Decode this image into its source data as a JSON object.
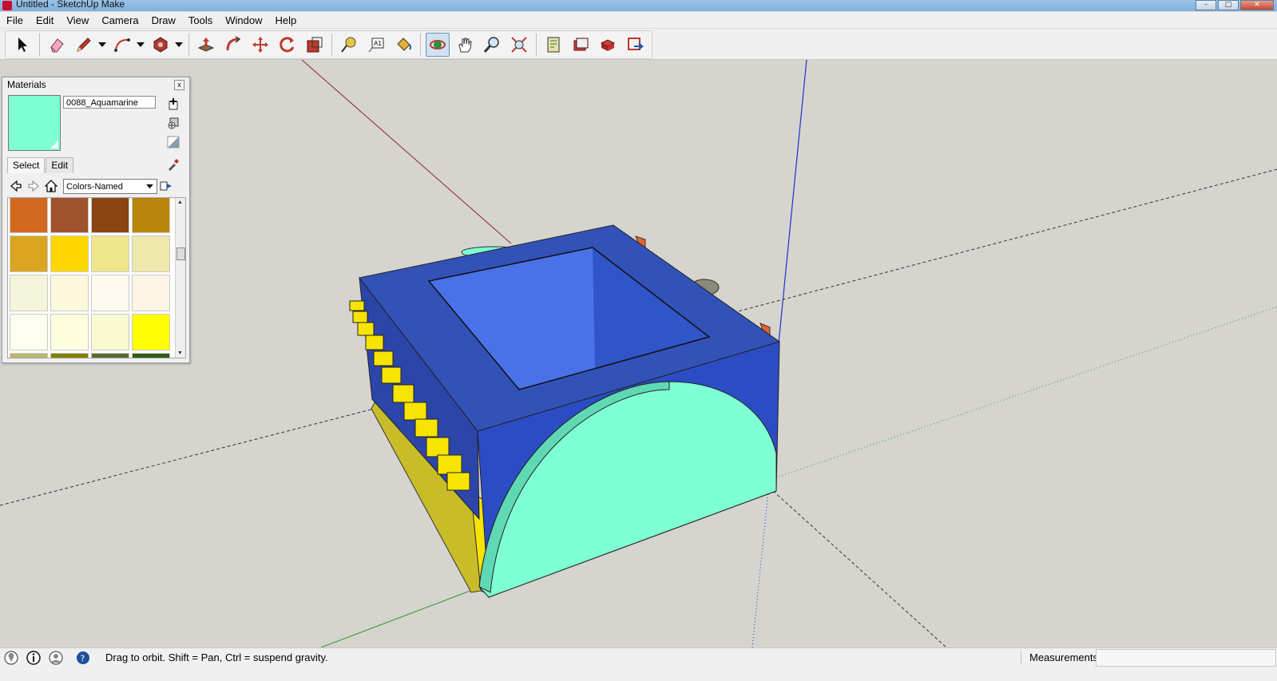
{
  "window": {
    "title": "Untitled - SketchUp Make",
    "controls": [
      "minimize",
      "maximize",
      "close"
    ]
  },
  "menu": [
    "File",
    "Edit",
    "View",
    "Camera",
    "Draw",
    "Tools",
    "Window",
    "Help"
  ],
  "toolbar": {
    "tools": [
      {
        "id": "select",
        "icon": "select-arrow-icon"
      },
      {
        "id": "eraser",
        "icon": "eraser-icon"
      },
      {
        "id": "line",
        "icon": "pencil-icon",
        "dropdown": true
      },
      {
        "id": "arc",
        "icon": "arc-icon",
        "dropdown": true
      },
      {
        "id": "shapes",
        "icon": "polygon-icon",
        "dropdown": true
      },
      {
        "id": "pushpull",
        "icon": "push-pull-icon"
      },
      {
        "id": "followme",
        "icon": "follow-me-icon"
      },
      {
        "id": "move",
        "icon": "move-icon"
      },
      {
        "id": "rotate",
        "icon": "rotate-icon"
      },
      {
        "id": "scale",
        "icon": "scale-icon"
      },
      {
        "id": "tape",
        "icon": "tape-measure-icon"
      },
      {
        "id": "text",
        "icon": "text-icon",
        "label": "A1"
      },
      {
        "id": "paint",
        "icon": "paint-bucket-icon"
      },
      {
        "id": "orbit",
        "icon": "orbit-icon",
        "active": true
      },
      {
        "id": "pan",
        "icon": "hand-icon"
      },
      {
        "id": "zoom",
        "icon": "zoom-icon"
      },
      {
        "id": "zoomextents",
        "icon": "zoom-extents-icon"
      },
      {
        "id": "warehouse",
        "icon": "warehouse-icon"
      },
      {
        "id": "share",
        "icon": "share-model-icon"
      },
      {
        "id": "components",
        "icon": "components-icon"
      },
      {
        "id": "extensions",
        "icon": "extension-icon"
      }
    ]
  },
  "materials": {
    "title": "Materials",
    "close": "x",
    "current_material": "0088_Aquamarine",
    "current_color": "#7fffd4",
    "tabs": [
      "Select",
      "Edit"
    ],
    "active_tab": "Select",
    "collection": "Colors-Named",
    "swatches": [
      "#d2691e",
      "#a0522d",
      "#8b4513",
      "#b8860b",
      "#daa520",
      "#ffd700",
      "#f0e68c",
      "#eee8aa",
      "#f5f5dc",
      "#fff8dc",
      "#fffaf0",
      "#fdf5e6",
      "#fffff0",
      "#ffffe0",
      "#fafad2",
      "#ffff00",
      "#bdb76b",
      "#808000",
      "#556b2f",
      "#2e5e0f"
    ]
  },
  "status": {
    "message": "Drag to orbit. Shift = Pan, Ctrl = suspend gravity.",
    "measurements_label": "Measurements",
    "measurements_value": ""
  },
  "colors": {
    "box_top": "#3352b8",
    "box_side": "#2b4cc4",
    "cavity": "#4169e1",
    "aquamarine": "#7fffd4",
    "gear_yellow": "#f7e400"
  }
}
